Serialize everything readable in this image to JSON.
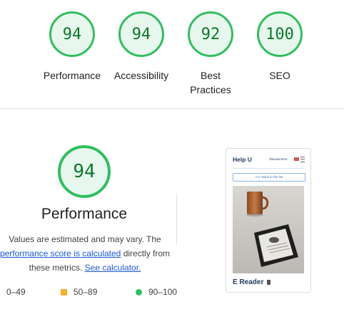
{
  "summary": {
    "gauges": [
      {
        "score": "94",
        "label": "Performance"
      },
      {
        "score": "94",
        "label": "Accessibility"
      },
      {
        "score": "92",
        "label": "Best Practices"
      },
      {
        "score": "100",
        "label": "SEO"
      }
    ]
  },
  "performance": {
    "score": "94",
    "title": "Performance",
    "desc_prefix": "Values are estimated and may vary. The",
    "desc_link": "performance score is calculated",
    "desc_mid": "directly from these metrics.",
    "calc_link": "See calculator.",
    "legend": [
      {
        "range": "0–49",
        "color": "#e53935"
      },
      {
        "range": "50–89",
        "color": "#fbae2c"
      },
      {
        "range": "90–100",
        "color": "#2fbf5e"
      }
    ]
  },
  "preview": {
    "site_title": "Help U",
    "language": "Obvuna Erre",
    "back_button": "<<< Back to the list",
    "caption": "E Reader"
  },
  "colors": {
    "pass": "#2fbf5e",
    "average": "#fbae2c",
    "fail": "#e53935",
    "link": "#1a57d6"
  }
}
